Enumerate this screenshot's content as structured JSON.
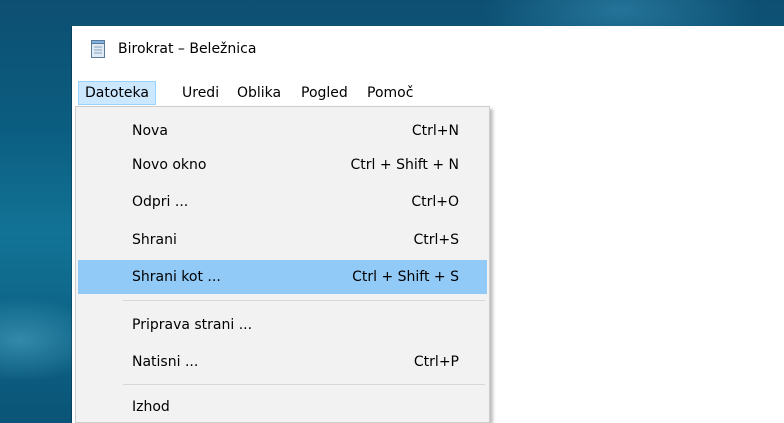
{
  "window": {
    "title": "Birokrat – Beležnica",
    "icon": "notepad-icon"
  },
  "menubar": {
    "items": [
      {
        "label": "Datoteka",
        "active": true
      },
      {
        "label": "Uredi"
      },
      {
        "label": "Oblika"
      },
      {
        "label": "Pogled"
      },
      {
        "label": "Pomoč"
      }
    ]
  },
  "file_menu": {
    "items": [
      {
        "label": "Nova",
        "shortcut": "Ctrl+N"
      },
      {
        "label": "Novo okno",
        "shortcut": "Ctrl + Shift + N"
      },
      {
        "label": "Odpri ...",
        "shortcut": "Ctrl+O"
      },
      {
        "label": "Shrani",
        "shortcut": "Ctrl+S"
      },
      {
        "label": "Shrani kot ...",
        "shortcut": "Ctrl + Shift + S",
        "highlighted": true
      },
      {
        "label": "Priprava strani ...",
        "shortcut": ""
      },
      {
        "label": "Natisni ...",
        "shortcut": "Ctrl+P"
      },
      {
        "label": "Izhod",
        "shortcut": ""
      }
    ]
  },
  "colors": {
    "menu_highlight": "#91c9f7",
    "menubar_active": "#cce8ff",
    "menu_background": "#f2f2f2",
    "desktop": "#0e6588"
  }
}
